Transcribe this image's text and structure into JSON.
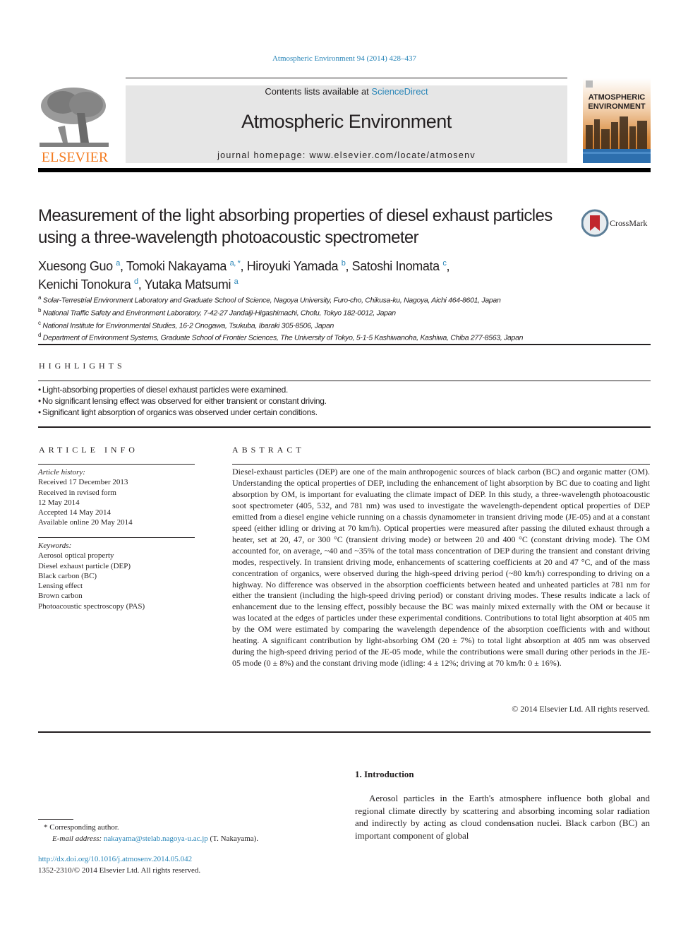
{
  "header": {
    "citation": "Atmospheric Environment 94 (2014) 428–437",
    "contents_prefix": "Contents lists available at ",
    "contents_link": "ScienceDirect",
    "journal_title": "Atmospheric Environment",
    "homepage_prefix": "journal homepage: ",
    "homepage_url": "www.elsevier.com/locate/atmosenv",
    "publisher_logo_text": "ELSEVIER",
    "cover_title_line1": "ATMOSPHERIC",
    "cover_title_line2": "ENVIRONMENT"
  },
  "colors": {
    "link": "#2a86b8",
    "elsevier_orange": "#f47b20",
    "masthead_gray": "#e6e6e6"
  },
  "article": {
    "title": "Measurement of the light absorbing properties of diesel exhaust particles using a three-wavelength photoacoustic spectrometer",
    "crossmark_label": "CrossMark",
    "authors": [
      {
        "name": "Xuesong Guo",
        "sup": "a",
        "sep": ", "
      },
      {
        "name": "Tomoki Nakayama",
        "sup": "a, *",
        "sep": ", "
      },
      {
        "name": "Hiroyuki Yamada",
        "sup": "b",
        "sep": ", "
      },
      {
        "name": "Satoshi Inomata",
        "sup": "c",
        "sep": ","
      },
      {
        "name": "Kenichi Tonokura",
        "sup": "d",
        "sep": ", "
      },
      {
        "name": "Yutaka Matsumi",
        "sup": "a",
        "sep": ""
      }
    ],
    "affiliations": [
      {
        "key": "a",
        "text": "Solar-Terrestrial Environment Laboratory and Graduate School of Science, Nagoya University, Furo-cho, Chikusa-ku, Nagoya, Aichi 464-8601, Japan"
      },
      {
        "key": "b",
        "text": "National Traffic Safety and Environment Laboratory, 7-42-27 Jandaiji-Higashimachi, Chofu, Tokyo 182-0012, Japan"
      },
      {
        "key": "c",
        "text": "National Institute for Environmental Studies, 16-2 Onogawa, Tsukuba, Ibaraki 305-8506, Japan"
      },
      {
        "key": "d",
        "text": "Department of Environment Systems, Graduate School of Frontier Sciences, The University of Tokyo, 5-1-5 Kashiwanoha, Kashiwa, Chiba 277-8563, Japan"
      }
    ]
  },
  "highlights": {
    "heading": "HIGHLIGHTS",
    "items": [
      "Light-absorbing properties of diesel exhaust particles were examined.",
      "No significant lensing effect was observed for either transient or constant driving.",
      "Significant light absorption of organics was observed under certain conditions."
    ]
  },
  "article_info": {
    "heading": "ARTICLE INFO",
    "history_label": "Article history:",
    "history": [
      "Received 17 December 2013",
      "Received in revised form",
      "12 May 2014",
      "Accepted 14 May 2014",
      "Available online 20 May 2014"
    ],
    "keywords_label": "Keywords:",
    "keywords": [
      "Aerosol optical property",
      "Diesel exhaust particle (DEP)",
      "Black carbon (BC)",
      "Lensing effect",
      "Brown carbon",
      "Photoacoustic spectroscopy (PAS)"
    ]
  },
  "abstract": {
    "heading": "ABSTRACT",
    "text": "Diesel-exhaust particles (DEP) are one of the main anthropogenic sources of black carbon (BC) and organic matter (OM). Understanding the optical properties of DEP, including the enhancement of light absorption by BC due to coating and light absorption by OM, is important for evaluating the climate impact of DEP. In this study, a three-wavelength photoacoustic soot spectrometer (405, 532, and 781 nm) was used to investigate the wavelength-dependent optical properties of DEP emitted from a diesel engine vehicle running on a chassis dynamometer in transient driving mode (JE-05) and at a constant speed (either idling or driving at 70 km/h). Optical properties were measured after passing the diluted exhaust through a heater, set at 20, 47, or 300 °C (transient driving mode) or between 20 and 400 °C (constant driving mode). The OM accounted for, on average, ~40 and ~35% of the total mass concentration of DEP during the transient and constant driving modes, respectively. In transient driving mode, enhancements of scattering coefficients at 20 and 47 °C, and of the mass concentration of organics, were observed during the high-speed driving period (~80 km/h) corresponding to driving on a highway. No difference was observed in the absorption coefficients between heated and unheated particles at 781 nm for either the transient (including the high-speed driving period) or constant driving modes. These results indicate a lack of enhancement due to the lensing effect, possibly because the BC was mainly mixed externally with the OM or because it was located at the edges of particles under these experimental conditions. Contributions to total light absorption at 405 nm by the OM were estimated by comparing the wavelength dependence of the absorption coefficients with and without heating. A significant contribution by light-absorbing OM (20 ± 7%) to total light absorption at 405 nm was observed during the high-speed driving period of the JE-05 mode, while the contributions were small during other periods in the JE-05 mode (0 ± 8%) and the constant driving mode (idling: 4 ± 12%; driving at 70 km/h: 0 ± 16%).",
    "copyright": "© 2014 Elsevier Ltd. All rights reserved."
  },
  "introduction": {
    "heading": "1.  Introduction",
    "text": "Aerosol particles in the Earth's atmosphere influence both global and regional climate directly by scattering and absorbing incoming solar radiation and indirectly by acting as cloud condensation nuclei. Black carbon (BC) an important component of global"
  },
  "footnote": {
    "corresponding": "* Corresponding author.",
    "email_label": "E-mail address: ",
    "email": "nakayama@stelab.nagoya-u.ac.jp",
    "email_suffix": " (T. Nakayama).",
    "doi": "http://dx.doi.org/10.1016/j.atmosenv.2014.05.042",
    "issn_copyright": "1352-2310/© 2014 Elsevier Ltd. All rights reserved."
  }
}
